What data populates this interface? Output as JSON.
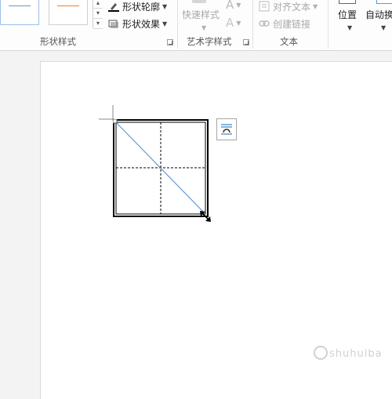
{
  "ribbon": {
    "shape_styles": {
      "group_label": "形状样式",
      "outline_label": "形状轮廓",
      "effects_label": "形状效果",
      "swatch_colors": [
        "#5b9bd5",
        "#ed7d31"
      ]
    },
    "wordart_styles": {
      "group_label": "艺术字样式",
      "quick_styles_label": "快速样式"
    },
    "text": {
      "group_label": "文本",
      "align_text_label": "对齐文本",
      "create_link_label": "创建链接"
    },
    "arrange": {
      "position_label": "位置",
      "wrap_text_label": "自动换"
    }
  },
  "colors": {
    "accent": "#5b9bd5",
    "diagonal": "#5b9bd5",
    "shape_border": "#000000"
  },
  "watermark": {
    "text": "shuhuiba"
  }
}
